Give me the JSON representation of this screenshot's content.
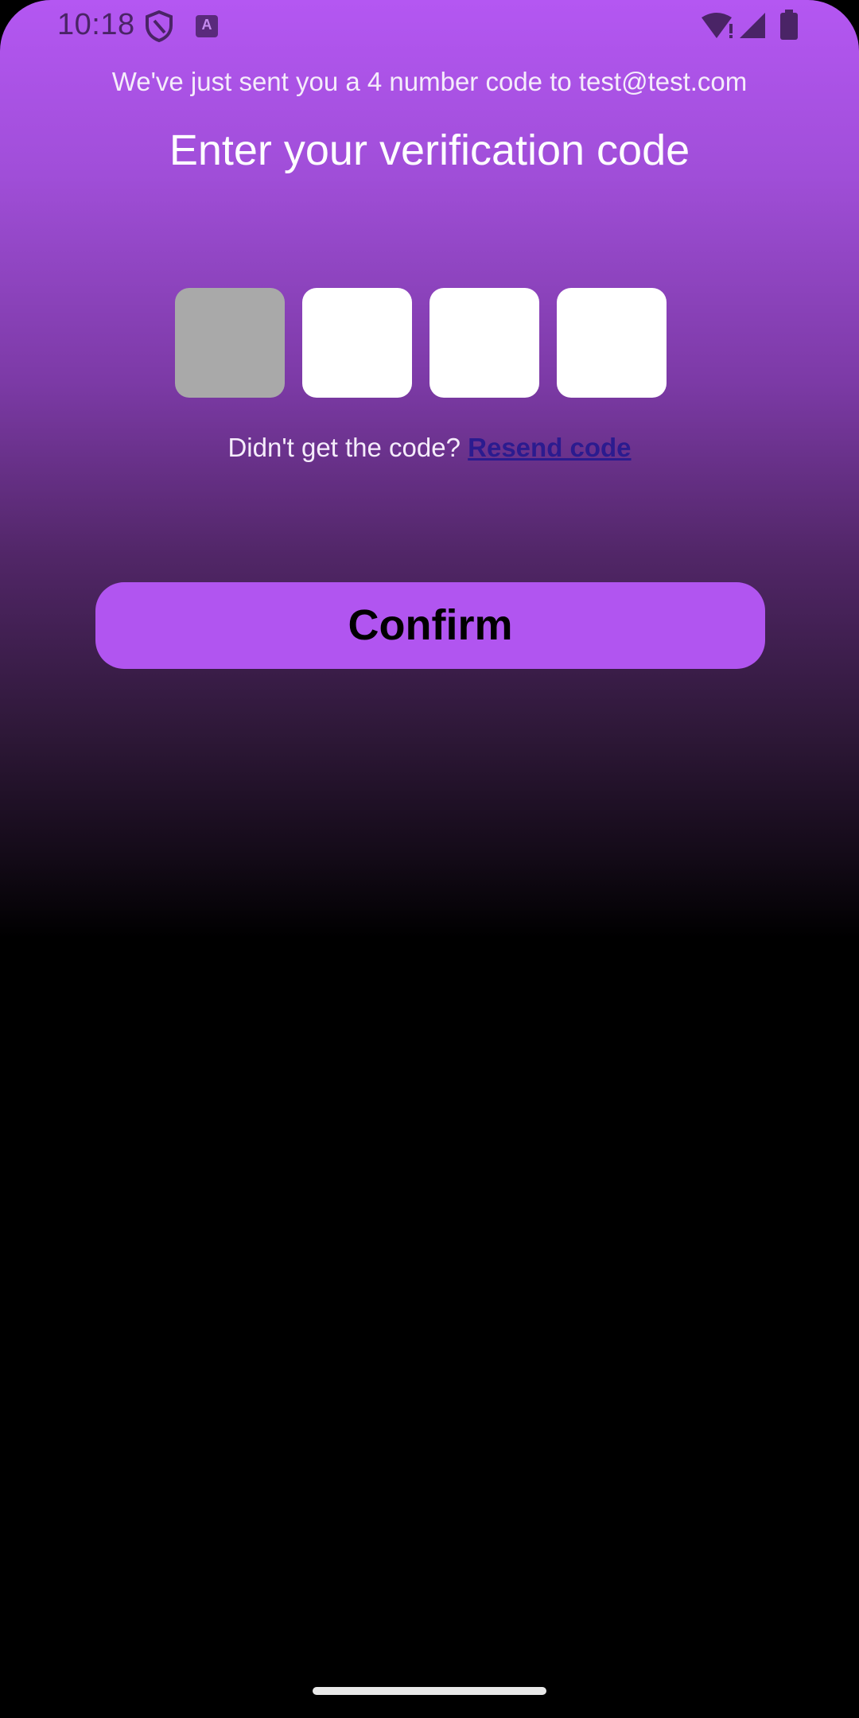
{
  "status_bar": {
    "time": "10:18",
    "icons": [
      "shield-icon",
      "accessibility-a-icon",
      "wifi-alert-icon",
      "cellular-signal-icon",
      "battery-icon"
    ],
    "a_icon_glyph": "A"
  },
  "header": {
    "subtitle": "We've just sent you a 4 number code to test@test.com",
    "title": "Enter your verification code"
  },
  "code_inputs": {
    "count": 4,
    "values": [
      "",
      "",
      "",
      ""
    ],
    "focused_index": 0
  },
  "resend": {
    "prompt": "Didn't get the code?",
    "link_label": "Resend code"
  },
  "actions": {
    "confirm_label": "Confirm"
  },
  "colors": {
    "accent": "#b155f0",
    "gradient_top": "#b457f2",
    "background_bottom": "#000000",
    "link": "#2b1b8f",
    "active_box": "#a9a9a9",
    "box": "#ffffff"
  }
}
